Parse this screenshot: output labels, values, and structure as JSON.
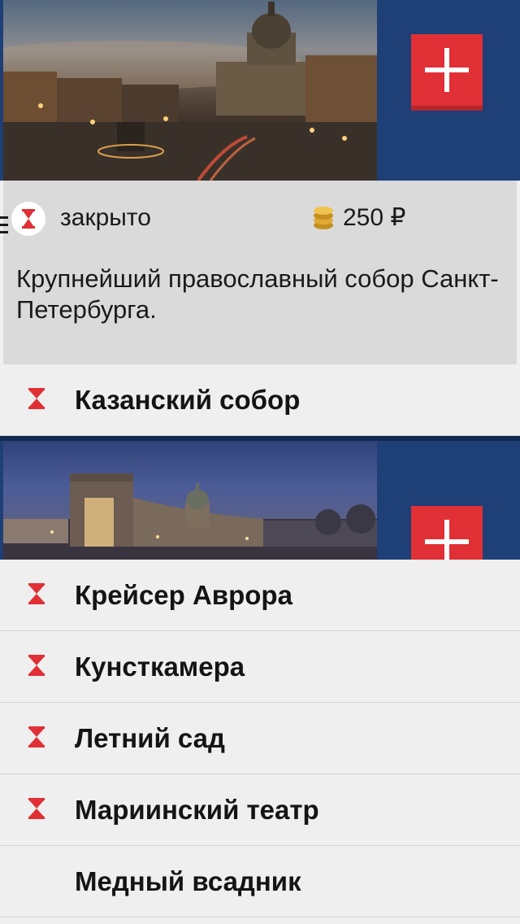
{
  "expanded_place": {
    "status": "закрыто",
    "price": "250 ₽",
    "description": "Крупнейший православный собор Санкт-Петербурга.",
    "add_button_icon": "plus-icon",
    "status_icon": "hourglass-icon",
    "price_icon": "coins-icon"
  },
  "places": [
    {
      "name": "Казанский собор"
    },
    {
      "name": "Крейсер Аврора"
    },
    {
      "name": "Кунсткамера"
    },
    {
      "name": "Летний сад"
    },
    {
      "name": "Мариинский театр"
    },
    {
      "name": "Медный всадник"
    }
  ],
  "colors": {
    "card_background": "#1f3f77",
    "accent_red": "#e03035",
    "list_background": "#efefef",
    "info_panel": "#dadada"
  }
}
